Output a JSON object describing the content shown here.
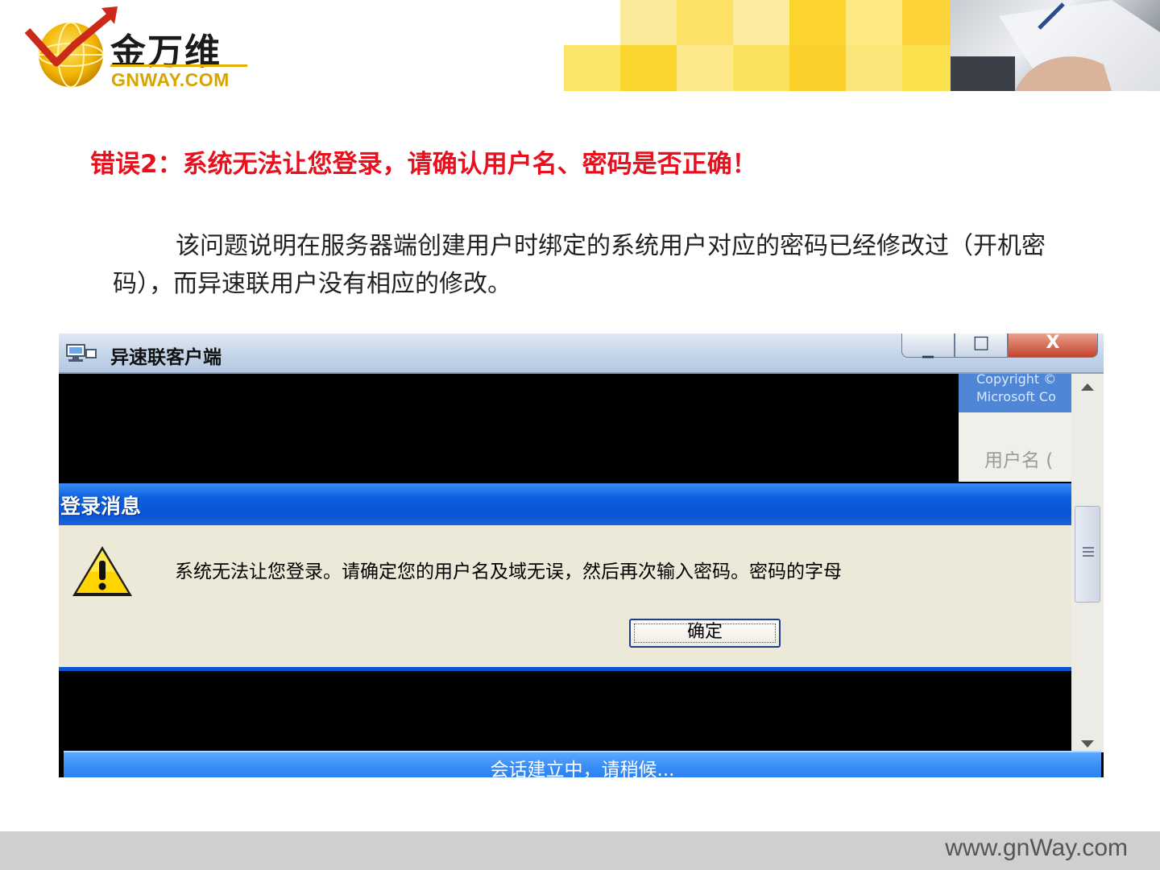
{
  "brand": {
    "name_cn": "金万维",
    "name_en": "GNWAY.COM"
  },
  "slide": {
    "error_title": "错误2：系统无法让您登录，请确认用户名、密码是否正确！",
    "paragraph": "该问题说明在服务器端创建用户时绑定的系统用户对应的密码已经修改过（开机密码），而异速联用户没有相应的修改。"
  },
  "screenshot": {
    "window_title": "异速联客户端",
    "window_icon": "computer-network-icon",
    "controls": {
      "minimize": "▁",
      "maximize": "□",
      "close": "X"
    },
    "right_panel": {
      "copyright_line1": "Copyright ©",
      "copyright_line2": "Microsoft Co",
      "username_label": "用户名 ("
    },
    "dialog": {
      "title": "登录消息",
      "icon": "warning-icon",
      "message": "系统无法让您登录。请确定您的用户名及域无误，然后再次输入密码。密码的字母",
      "ok_label": "确定"
    },
    "status": "会话建立中，请稍候..."
  },
  "footer": {
    "url": "www.gnWay.com"
  },
  "colors": {
    "error_red": "#e8101e",
    "xp_blue": "#0a55d2",
    "dialog_bg": "#ece9d8",
    "brand_gold": "#e4b000"
  }
}
